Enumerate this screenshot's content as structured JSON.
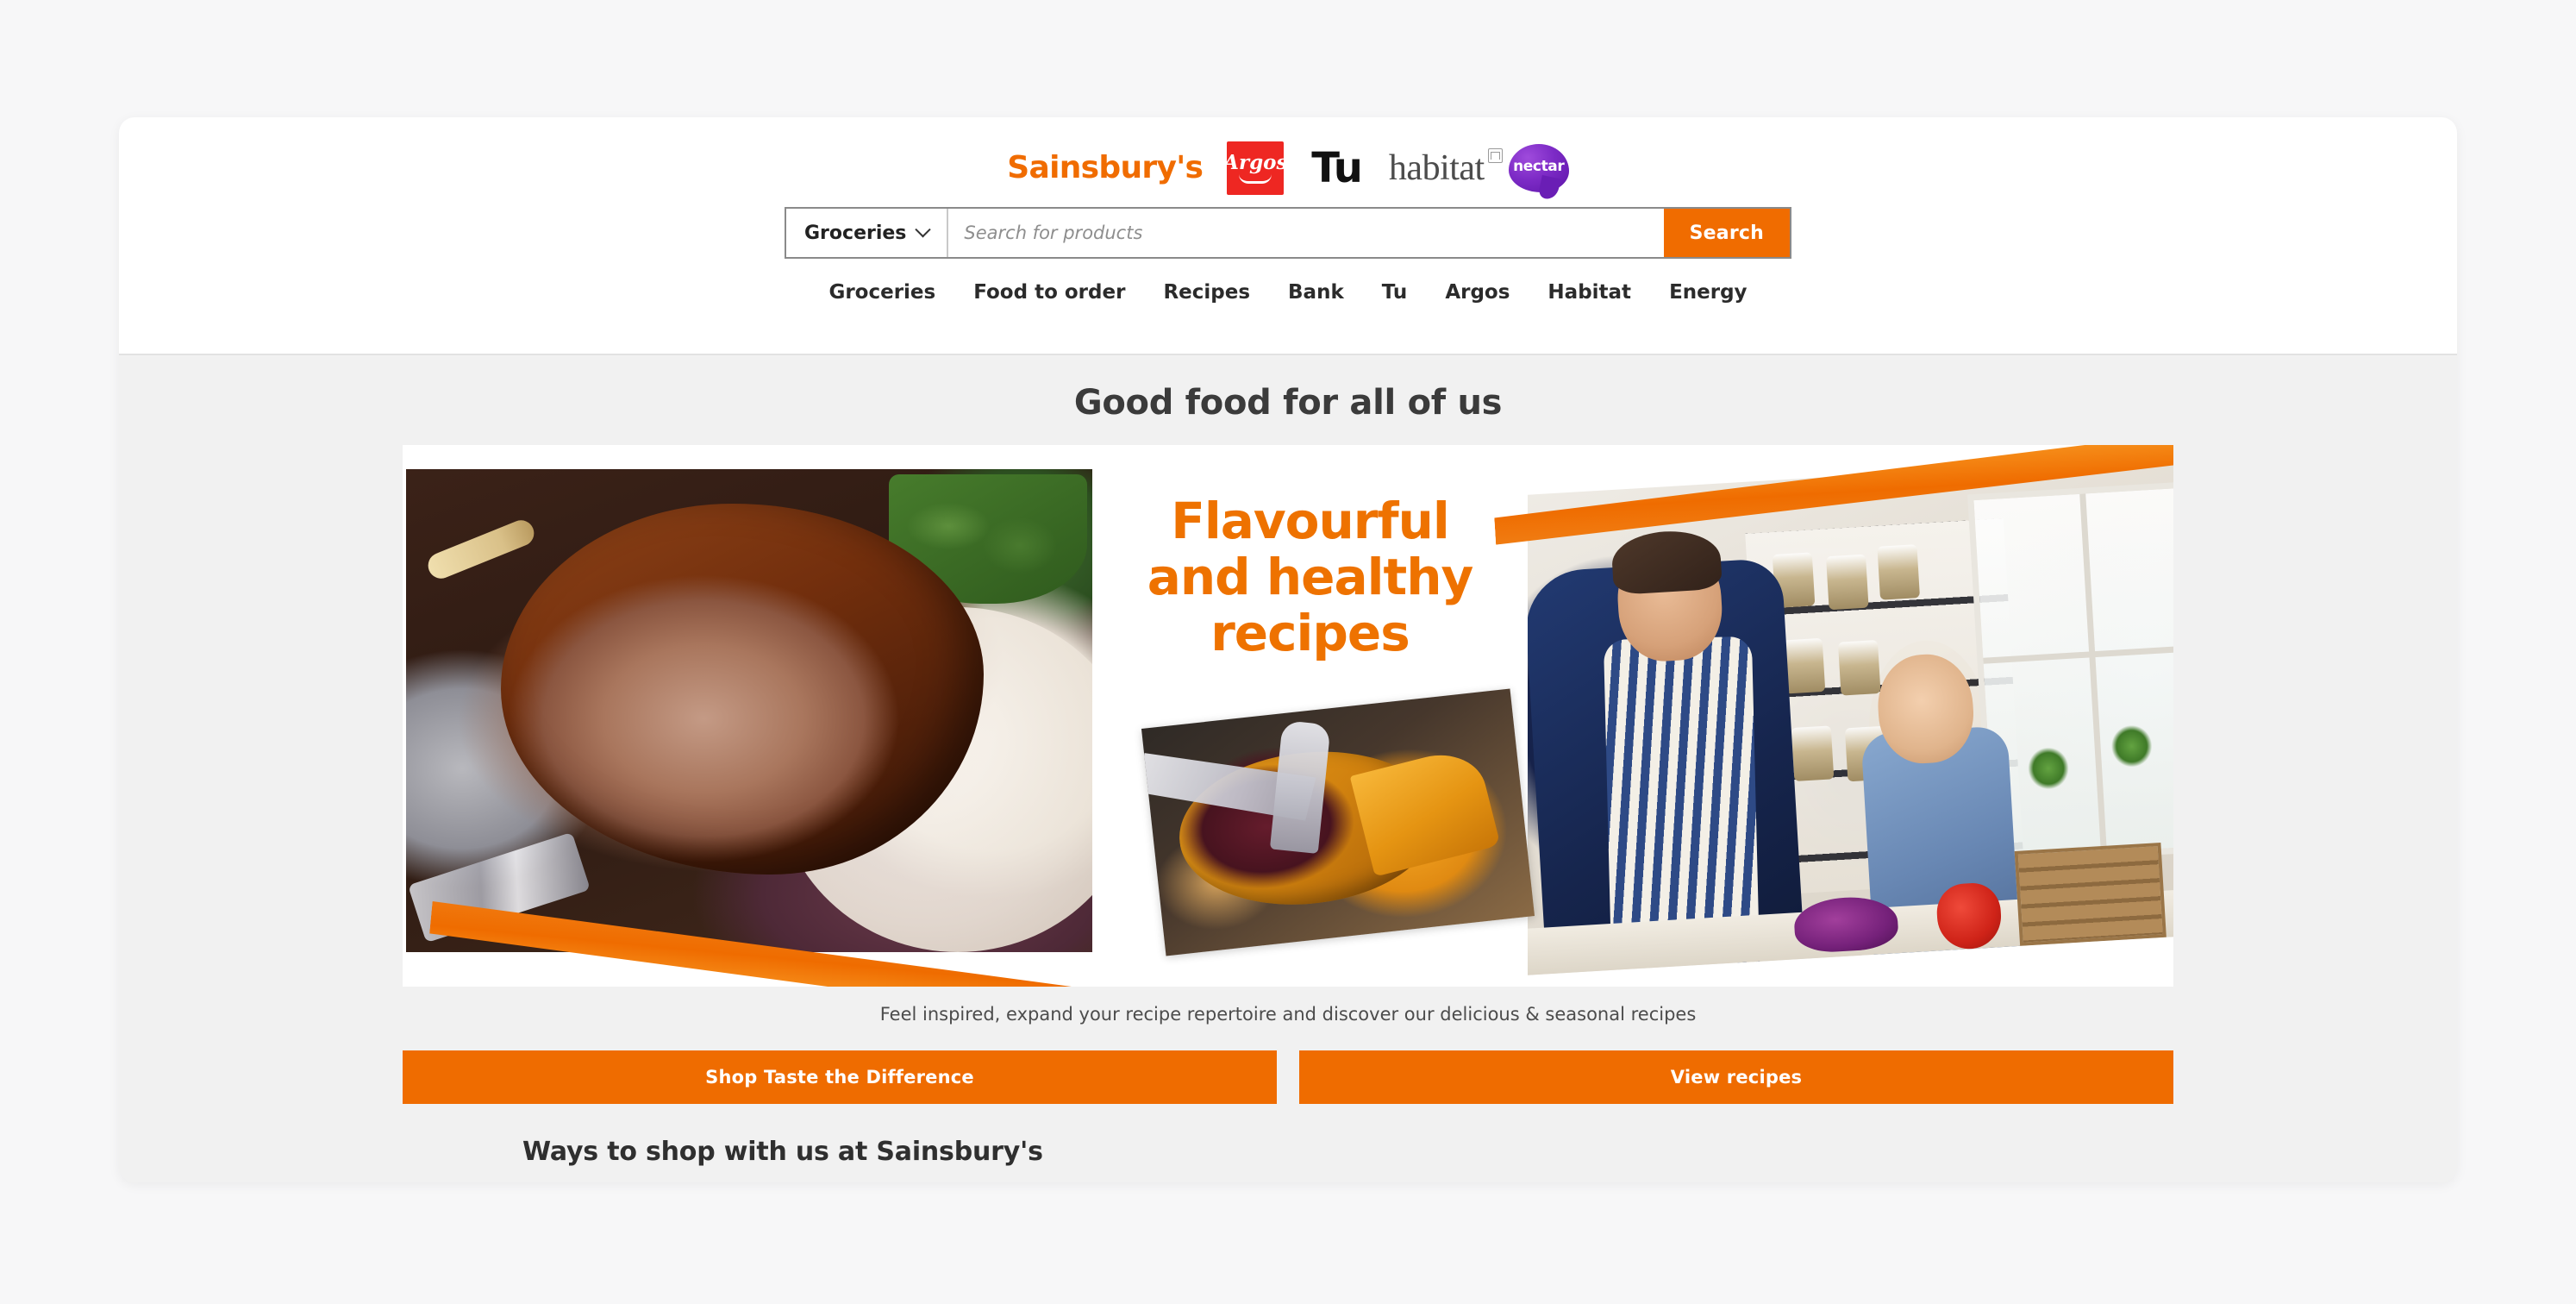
{
  "brands": [
    {
      "name": "Sainsbury's",
      "icon": "sainsburys-logo",
      "color": "#f06c00"
    },
    {
      "name": "Argos",
      "icon": "argos-logo",
      "color": "#ee2722"
    },
    {
      "name": "Tu",
      "icon": "tu-logo",
      "color": "#111111"
    },
    {
      "name": "habitat",
      "icon": "habitat-logo",
      "color": "#4c4c4c"
    },
    {
      "name": "nectar",
      "icon": "nectar-logo",
      "color": "#7d2bc6"
    }
  ],
  "search": {
    "scope_label": "Groceries",
    "scope_icon": "chevron-down-icon",
    "placeholder": "Search for products",
    "value": "",
    "submit_label": "Search"
  },
  "nav": {
    "items": [
      {
        "label": "Groceries"
      },
      {
        "label": "Food to order"
      },
      {
        "label": "Recipes"
      },
      {
        "label": "Bank"
      },
      {
        "label": "Tu"
      },
      {
        "label": "Argos"
      },
      {
        "label": "Habitat"
      },
      {
        "label": "Energy"
      }
    ]
  },
  "main": {
    "page_title": "Good food for all of us",
    "hero": {
      "headline_line1": "Flavourful",
      "headline_line2": "and healthy",
      "headline_line3": "recipes",
      "headline_color": "#ee7200",
      "image_left_alt": "roast-lamb-joint-photo",
      "image_center_alt": "sliced-tart-with-fork-photo",
      "image_right_alt": "father-and-daughter-cooking-photo"
    },
    "caption": "Feel inspired, expand your recipe repertoire and discover our delicious & seasonal recipes",
    "cta": [
      {
        "label": "Shop Taste the Difference"
      },
      {
        "label": "View recipes"
      }
    ],
    "section_heading": "Ways to shop with us at Sainsbury's"
  },
  "theme": {
    "accent_orange": "#ef6c00",
    "page_background": "#f7f7f8",
    "content_background": "#f1f1f1",
    "header_background": "#ffffff"
  }
}
